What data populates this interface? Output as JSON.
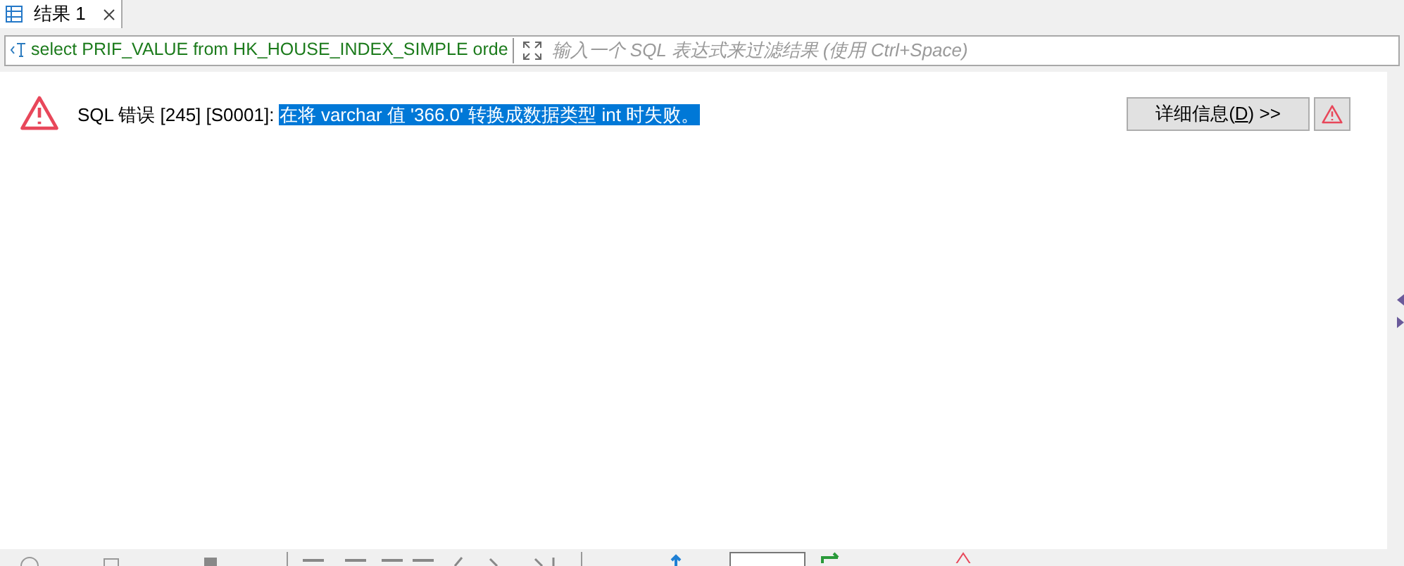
{
  "tabs": [
    {
      "label": "结果 1",
      "selected": true
    }
  ],
  "filter": {
    "query": "select PRIF_VALUE from HK_HOUSE_INDEX_SIMPLE orde",
    "placeholder": "输入一个 SQL 表达式来过滤结果 (使用 Ctrl+Space)"
  },
  "error": {
    "prefix": "SQL 错误 [245] [S0001]: ",
    "selected_text": "在将 varchar 值 '366.0' 转换成数据类型 int 时失败。"
  },
  "details_button": {
    "label_before": "详细信息(",
    "mnemonic": "D",
    "label_after": ") >>"
  }
}
